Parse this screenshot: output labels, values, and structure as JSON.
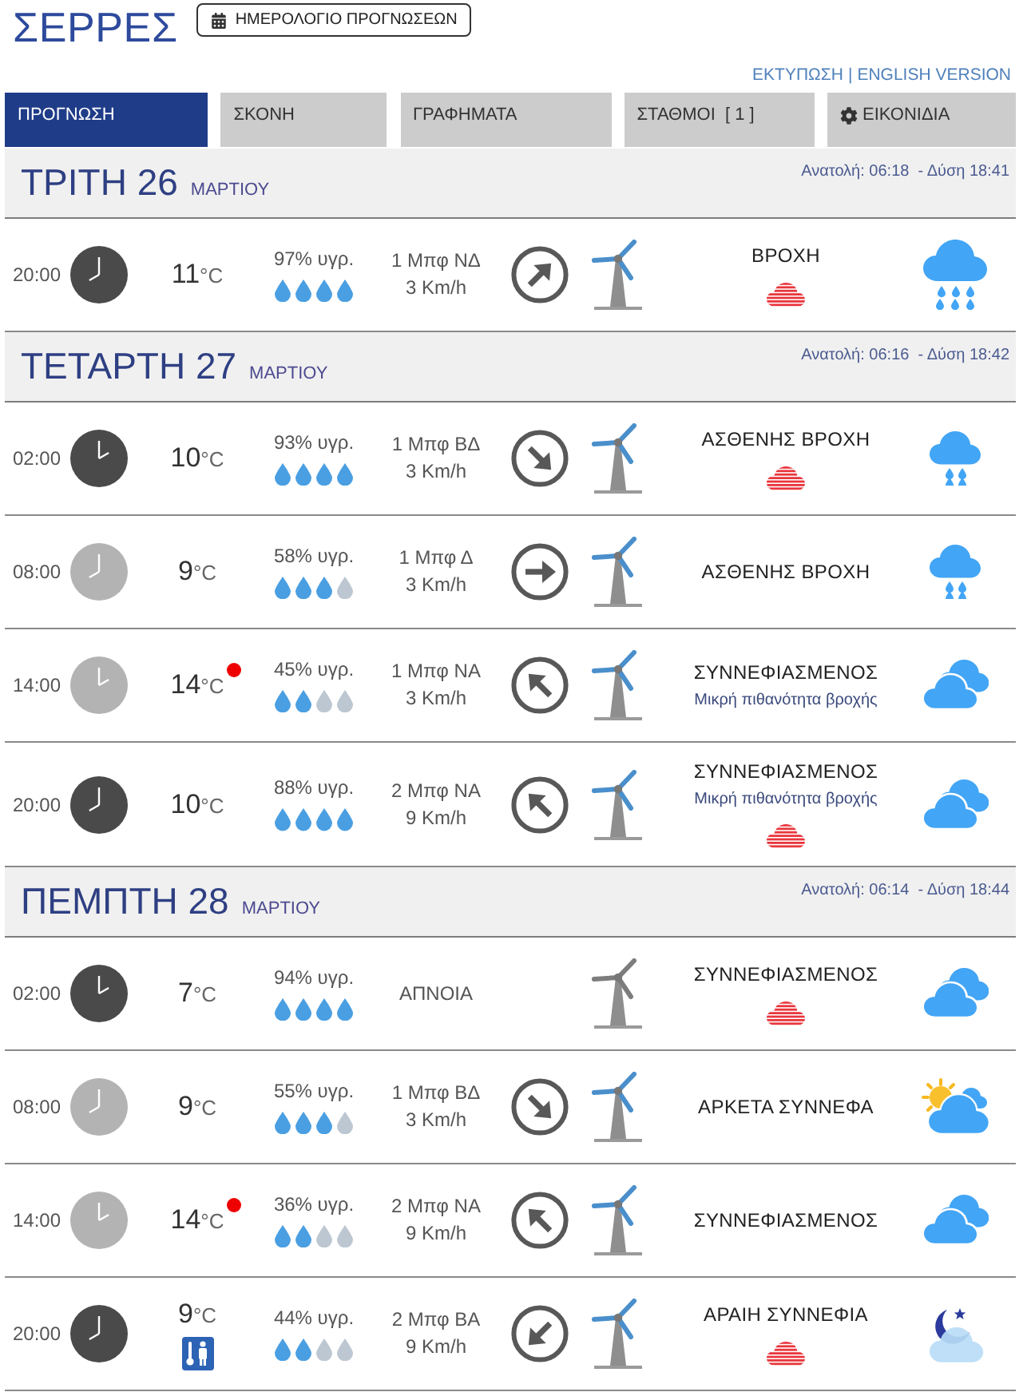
{
  "header": {
    "title": "ΣΕΡΡΕΣ",
    "calendar_button": "ΗΜΕΡΟΛΟΓΙΟ ΠΡΟΓΝΩΣΕΩΝ"
  },
  "links": {
    "items": [
      "ΕΚΤΥΠΩΣΗ",
      "ENGLISH VERSION"
    ],
    "separator": "|"
  },
  "tabs": [
    {
      "label": "ΠΡΟΓΝΩΣΗ",
      "selected": true,
      "kind": "plain"
    },
    {
      "label": "ΣΚΟΝΗ",
      "selected": false,
      "kind": "plain"
    },
    {
      "label": "ΓΡΑΦΗΜΑΤΑ",
      "selected": false,
      "kind": "plain"
    },
    {
      "label": "ΣΤΑΘΜΟΙ  [ 1 ]",
      "selected": false,
      "kind": "plain"
    },
    {
      "label": "ΕΙΚΟΝΙΔΙΑ",
      "selected": false,
      "kind": "gear"
    }
  ],
  "days": [
    {
      "day": "ΤΡΙΤΗ 26",
      "month": "ΜΑΡΤΙΟΥ",
      "sun": "Ανατολή: 06:18  - Δύση 18:41",
      "hours": [
        {
          "kind": "rain",
          "time": "20:00",
          "night": true,
          "temp": "11",
          "temp_unit": "°C",
          "temp_alert": false,
          "thermal_icon": false,
          "humidity": "97% υγρ.",
          "stars": 4,
          "wind": [
            "1 Μπφ ΝΔ",
            "3 Km/h"
          ],
          "arrow": {
            "kind": "ne"
          },
          "calm": false,
          "conditions": "ΒΡΟΧΗ",
          "striped_cloud": true
        }
      ]
    },
    {
      "day": "ΤΕΤΑΡΤΗ 27",
      "month": "ΜΑΡΤΙΟΥ",
      "sun": "Ανατολή: 06:16  - Δύση 18:42",
      "hours": [
        {
          "kind": "light_rain",
          "time": "02:00",
          "night": true,
          "temp": "10",
          "temp_unit": "°C",
          "temp_alert": false,
          "thermal_icon": false,
          "humidity": "93% υγρ.",
          "stars": 4,
          "wind": [
            "1 Μπφ ΒΔ",
            "3 Km/h"
          ],
          "arrow": {
            "kind": "se"
          },
          "calm": false,
          "conditions": "ΑΣΘΕΝΗΣ ΒΡΟΧΗ",
          "striped_cloud": true
        },
        {
          "kind": "light_rain",
          "time": "08:00",
          "night": false,
          "temp": "9",
          "temp_unit": "°C",
          "temp_alert": false,
          "thermal_icon": false,
          "humidity": "58% υγρ.",
          "stars": 3,
          "wind": [
            "1 Μπφ Δ",
            "3 Km/h"
          ],
          "arrow": {
            "kind": "e"
          },
          "calm": false,
          "conditions": "ΑΣΘΕΝΗΣ ΒΡΟΧΗ",
          "striped_cloud": false
        },
        {
          "kind": "cloudy",
          "time": "14:00",
          "night": false,
          "temp": "14",
          "temp_unit": "°C",
          "temp_alert": true,
          "thermal_icon": false,
          "humidity": "45% υγρ.",
          "stars": 2,
          "wind": [
            "1 Μπφ ΝΑ",
            "3 Km/h"
          ],
          "arrow": {
            "kind": "nw"
          },
          "calm": false,
          "conditions": "ΣΥΝΝΕΦΙΑΣΜΕΝΟΣ",
          "note": "Μικρή πιθανότητα βροχής",
          "striped_cloud": false
        },
        {
          "kind": "cloudy",
          "time": "20:00",
          "night": true,
          "temp": "10",
          "temp_unit": "°C",
          "temp_alert": false,
          "thermal_icon": false,
          "humidity": "88% υγρ.",
          "stars": 4,
          "wind": [
            "2 Μπφ ΝΑ",
            "9 Km/h"
          ],
          "arrow": {
            "kind": "nw"
          },
          "calm": false,
          "conditions": "ΣΥΝΝΕΦΙΑΣΜΕΝΟΣ",
          "note": "Μικρή πιθανότητα βροχής",
          "striped_cloud": true
        }
      ]
    },
    {
      "day": "ΠΕΜΠΤΗ 28",
      "month": "ΜΑΡΤΙΟΥ",
      "sun": "Ανατολή: 06:14  - Δύση 18:44",
      "hours": [
        {
          "kind": "cloudy",
          "time": "02:00",
          "night": true,
          "temp": "7",
          "temp_unit": "°C",
          "temp_alert": false,
          "thermal_icon": false,
          "humidity": "94% υγρ.",
          "stars": 4,
          "wind": [
            "ΑΠΝΟΙΑ"
          ],
          "calm": true,
          "conditions": "ΣΥΝΝΕΦΙΑΣΜΕΝΟΣ",
          "striped_cloud": true
        },
        {
          "kind": "partly_cloudy",
          "time": "08:00",
          "night": false,
          "temp": "9",
          "temp_unit": "°C",
          "temp_alert": false,
          "thermal_icon": false,
          "humidity": "55% υγρ.",
          "stars": 3,
          "wind": [
            "1 Μπφ ΒΔ",
            "3 Km/h"
          ],
          "arrow": {
            "kind": "se"
          },
          "calm": false,
          "conditions": "ΑΡΚΕΤΑ ΣΥΝΝΕΦΑ",
          "striped_cloud": false
        },
        {
          "kind": "cloudy",
          "time": "14:00",
          "night": false,
          "temp": "14",
          "temp_unit": "°C",
          "temp_alert": true,
          "thermal_icon": false,
          "humidity": "36% υγρ.",
          "stars": 2,
          "wind": [
            "2 Μπφ ΝΑ",
            "9 Km/h"
          ],
          "arrow": {
            "kind": "nw"
          },
          "calm": false,
          "conditions": "ΣΥΝΝΕΦΙΑΣΜΕΝΟΣ",
          "striped_cloud": false
        },
        {
          "kind": "night_clouds",
          "time": "20:00",
          "night": true,
          "temp": "9",
          "temp_unit": "°C",
          "temp_alert": false,
          "thermal_icon": true,
          "humidity": "44% υγρ.",
          "stars": 2,
          "wind": [
            "2 Μπφ ΒΑ",
            "9 Km/h"
          ],
          "arrow": {
            "kind": "sw"
          },
          "calm": false,
          "conditions": "ΑΡΑΙΗ ΣΥΝΝΕΦΙΑ",
          "striped_cloud": true
        }
      ]
    }
  ]
}
